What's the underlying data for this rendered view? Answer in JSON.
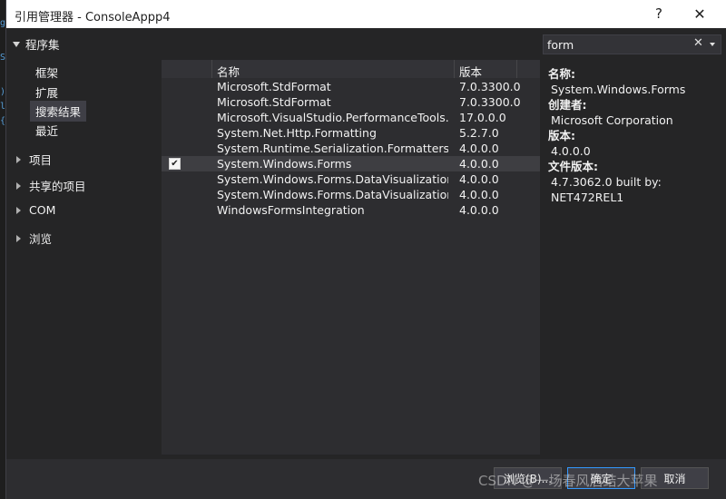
{
  "window": {
    "title": "引用管理器 - ConsoleAppp4",
    "help_glyph": "?",
    "close_glyph": "✕"
  },
  "nav": {
    "root": "程序集",
    "subitems": [
      "框架",
      "扩展",
      "搜索结果",
      "最近"
    ],
    "selected_subitem": "搜索结果",
    "groups": [
      "项目",
      "共享的项目",
      "COM",
      "浏览"
    ]
  },
  "list": {
    "columns": {
      "name": "名称",
      "version": "版本"
    },
    "rows": [
      {
        "name": "Microsoft.StdFormat",
        "version": "7.0.3300.0",
        "checked": false
      },
      {
        "name": "Microsoft.StdFormat",
        "version": "7.0.3300.0",
        "checked": false
      },
      {
        "name": "Microsoft.VisualStudio.PerformanceTools....",
        "version": "17.0.0.0",
        "checked": false
      },
      {
        "name": "System.Net.Http.Formatting",
        "version": "5.2.7.0",
        "checked": false
      },
      {
        "name": "System.Runtime.Serialization.Formatters.S...",
        "version": "4.0.0.0",
        "checked": false
      },
      {
        "name": "System.Windows.Forms",
        "version": "4.0.0.0",
        "checked": true,
        "selected": true
      },
      {
        "name": "System.Windows.Forms.DataVisualization",
        "version": "4.0.0.0",
        "checked": false
      },
      {
        "name": "System.Windows.Forms.DataVisualization....",
        "version": "4.0.0.0",
        "checked": false
      },
      {
        "name": "WindowsFormsIntegration",
        "version": "4.0.0.0",
        "checked": false
      }
    ],
    "check_glyph": "✔"
  },
  "search": {
    "value": "form",
    "clear_glyph": "✕"
  },
  "details": {
    "name_label": "名称:",
    "name_value": "System.Windows.Forms",
    "creator_label": "创建者:",
    "creator_value": "Microsoft Corporation",
    "version_label": "版本:",
    "version_value": "4.0.0.0",
    "file_version_label": "文件版本:",
    "file_version_value_1": "4.7.3062.0 built by:",
    "file_version_value_2": "NET472REL1"
  },
  "buttons": {
    "browse": "浏览(B)...",
    "ok": "确定",
    "cancel": "取消"
  },
  "watermark": "CSDN @一场春风后结大苹果",
  "colors": {
    "background": "#252526",
    "list_bg": "#2d2d30",
    "selected_row": "#3e3e42",
    "accent": "#3399ff"
  }
}
